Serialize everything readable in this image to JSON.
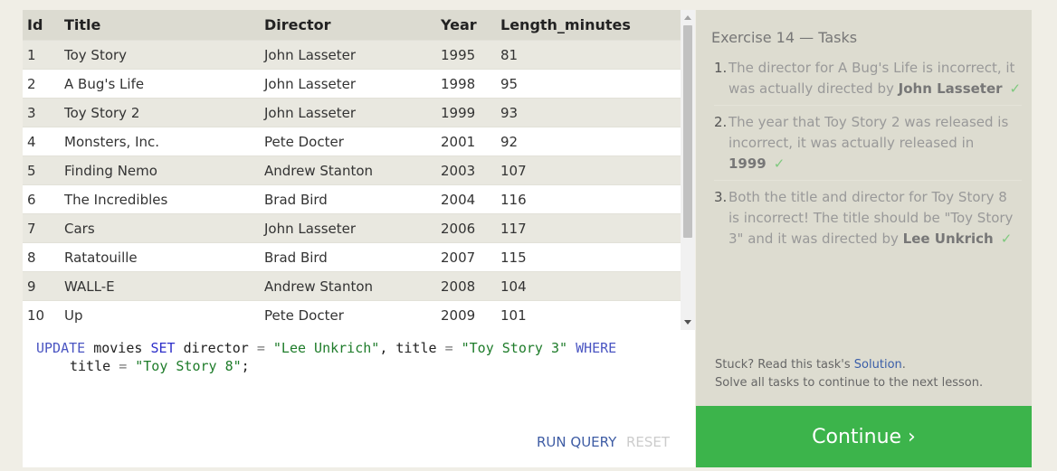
{
  "table": {
    "headers": [
      "Id",
      "Title",
      "Director",
      "Year",
      "Length_minutes"
    ],
    "rows": [
      [
        "1",
        "Toy Story",
        "John Lasseter",
        "1995",
        "81"
      ],
      [
        "2",
        "A Bug's Life",
        "John Lasseter",
        "1998",
        "95"
      ],
      [
        "3",
        "Toy Story 2",
        "John Lasseter",
        "1999",
        "93"
      ],
      [
        "4",
        "Monsters, Inc.",
        "Pete Docter",
        "2001",
        "92"
      ],
      [
        "5",
        "Finding Nemo",
        "Andrew Stanton",
        "2003",
        "107"
      ],
      [
        "6",
        "The Incredibles",
        "Brad Bird",
        "2004",
        "116"
      ],
      [
        "7",
        "Cars",
        "John Lasseter",
        "2006",
        "117"
      ],
      [
        "8",
        "Ratatouille",
        "Brad Bird",
        "2007",
        "115"
      ],
      [
        "9",
        "WALL-E",
        "Andrew Stanton",
        "2008",
        "104"
      ],
      [
        "10",
        "Up",
        "Pete Docter",
        "2009",
        "101"
      ]
    ]
  },
  "editor": {
    "tokens": {
      "update": "UPDATE",
      "table_name": "movies",
      "set": "SET",
      "col1": "director",
      "eq": "=",
      "val1": "\"Lee Unkrich\"",
      "comma": ",",
      "col2": "title",
      "val2": "\"Toy Story 3\"",
      "where": "WHERE",
      "col3": "title",
      "val3": "\"Toy Story 8\"",
      "semicolon": ";"
    }
  },
  "buttons": {
    "run_query": "RUN QUERY",
    "reset": "RESET",
    "continue": "Continue ›"
  },
  "exercise": {
    "title": "Exercise 14 — Tasks",
    "tasks": [
      {
        "num": "1.",
        "text": "The director for A Bug's Life is incorrect, it was actually directed by ",
        "bold": "John Lasseter",
        "check": "✓"
      },
      {
        "num": "2.",
        "text": "The year that Toy Story 2 was released is incorrect, it was actually released in ",
        "bold": "1999",
        "check": "✓"
      },
      {
        "num": "3.",
        "text": "Both the title and director for Toy Story 8 is incorrect! The title should be \"Toy Story 3\" and it was directed by ",
        "bold": "Lee Unkrich",
        "check": "✓"
      }
    ],
    "stuck_prefix": "Stuck? Read this task's ",
    "solution_link": "Solution",
    "stuck_suffix": ".",
    "solve_all": "Solve all tasks to continue to the next lesson."
  },
  "colors": {
    "continue_bg": "#3cb44b",
    "keyword": "#4a55c2",
    "string": "#1e7c2a",
    "link": "#3a5ea8"
  }
}
